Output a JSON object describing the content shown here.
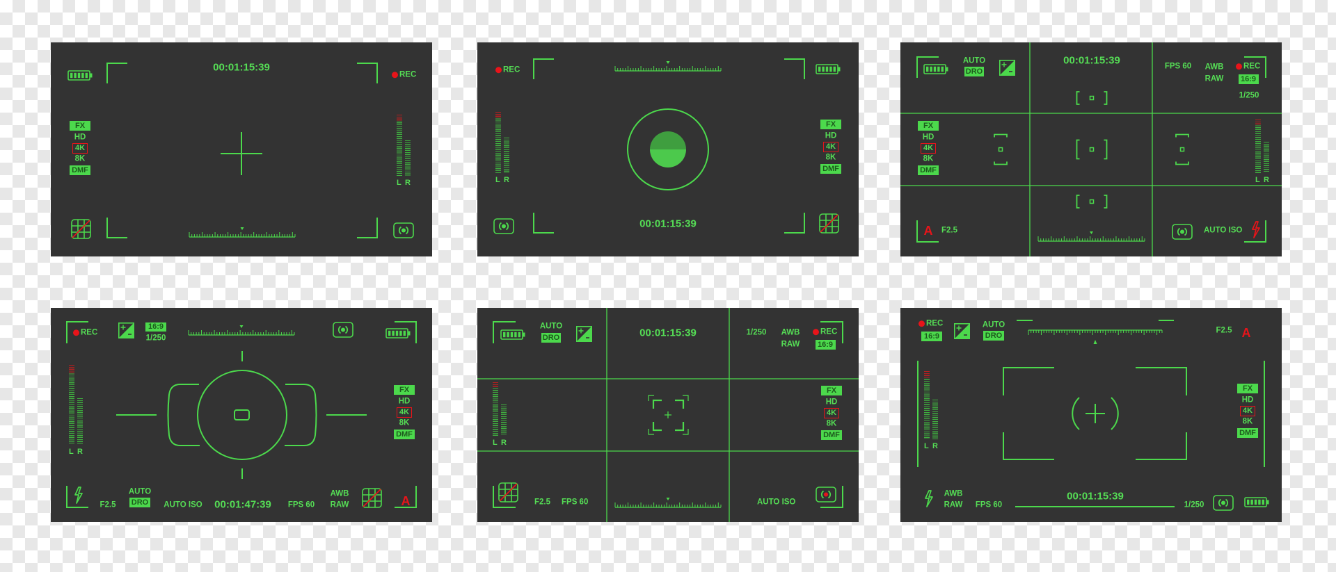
{
  "colors": {
    "panel": "#333333",
    "green": "#4cd94c",
    "text_green": "#55dd55",
    "red": "#e8141a",
    "badge_text": "#1d5a1d"
  },
  "icons": [
    "battery-icon",
    "exposure-compensation-icon",
    "camera-switch-icon",
    "grid-off-icon",
    "flash-icon",
    "rec-dot-icon",
    "audio-level-meter",
    "zoom-ruler"
  ],
  "panels": [
    {
      "timecode": "00:01:15:39",
      "rec": "REC",
      "modes": {
        "fx": "FX",
        "hd": "HD",
        "k4": "4K",
        "k8": "8K",
        "dmf": "DMF"
      },
      "meter": {
        "left": "L",
        "right": "R"
      }
    },
    {
      "timecode": "00:01:15:39",
      "rec": "REC",
      "modes": {
        "fx": "FX",
        "hd": "HD",
        "k4": "4K",
        "k8": "8K",
        "dmf": "DMF"
      },
      "meter": {
        "left": "L",
        "right": "R"
      }
    },
    {
      "timecode": "00:01:15:39",
      "rec": "REC",
      "auto": "AUTO",
      "dro": "DRO",
      "fps": "FPS 60",
      "awb": "AWB",
      "raw": "RAW",
      "ratio": "16:9",
      "shutter": "1/250",
      "aperture": "F2.5",
      "mode": "A",
      "iso": "AUTO ISO",
      "modes": {
        "fx": "FX",
        "hd": "HD",
        "k4": "4K",
        "k8": "8K",
        "dmf": "DMF"
      },
      "meter": {
        "left": "L",
        "right": "R"
      }
    },
    {
      "timecode": "00:01:47:39",
      "rec": "REC",
      "ratio": "16:9",
      "shutter": "1/250",
      "auto": "AUTO",
      "dro": "DRO",
      "aperture": "F2.5",
      "iso": "AUTO ISO",
      "fps": "FPS 60",
      "awb": "AWB",
      "raw": "RAW",
      "mode": "A",
      "modes": {
        "fx": "FX",
        "hd": "HD",
        "k4": "4K",
        "k8": "8K",
        "dmf": "DMF"
      },
      "meter": {
        "left": "L",
        "right": "R"
      }
    },
    {
      "timecode": "00:01:15:39",
      "rec": "REC",
      "auto": "AUTO",
      "dro": "DRO",
      "shutter": "1/250",
      "awb": "AWB",
      "raw": "RAW",
      "ratio": "16:9",
      "aperture": "F2.5",
      "fps": "FPS 60",
      "iso": "AUTO ISO",
      "modes": {
        "fx": "FX",
        "hd": "HD",
        "k4": "4K",
        "k8": "8K",
        "dmf": "DMF"
      },
      "meter": {
        "left": "L",
        "right": "R"
      }
    },
    {
      "timecode": "00:01:15:39",
      "rec": "REC",
      "ratio": "16:9",
      "auto": "AUTO",
      "dro": "DRO",
      "aperture": "F2.5",
      "mode": "A",
      "awb": "AWB",
      "raw": "RAW",
      "fps": "FPS 60",
      "shutter": "1/250",
      "modes": {
        "fx": "FX",
        "hd": "HD",
        "k4": "4K",
        "k8": "8K",
        "dmf": "DMF"
      },
      "meter": {
        "left": "L",
        "right": "R"
      }
    }
  ]
}
